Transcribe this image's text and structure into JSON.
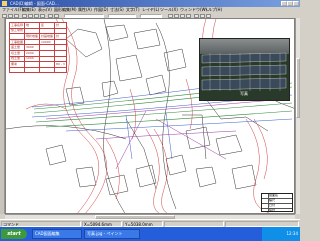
{
  "window": {
    "title": "CAD(D)编辑 - 図面-CAD…"
  },
  "menu": {
    "items": [
      "ファイル(F)",
      "編集(E)",
      "表示(V)",
      "図形編集(M)",
      "属性(A)",
      "作図(D)",
      "寸法(S)",
      "文字(T)",
      "レイヤ(L)",
      "ツール(X)",
      "ウィンドウ(W)",
      "ヘルプ(H)"
    ]
  },
  "table": {
    "rows": [
      [
        "工事名称",
        "地",
        "区",
        "計"
      ],
      [
        "施工場所",
        "",
        "",
        ""
      ],
      [
        "",
        "現状地盤",
        "計画地盤",
        "計"
      ],
      [
        "工事範囲",
        "",
        "10000",
        ""
      ],
      [
        "盛土量",
        "3000",
        "",
        ""
      ],
      [
        "切土量",
        "2000",
        "",
        ""
      ],
      [
        "残土量",
        "1000",
        "",
        ""
      ],
      [
        "備考",
        "",
        "",
        "80 - 3"
      ],
      [
        "",
        "",
        "",
        ""
      ]
    ]
  },
  "photo": {
    "caption": "写真"
  },
  "frame": {
    "rows": [
      "図面名",
      "縮尺",
      "日付",
      "設計"
    ]
  },
  "status": {
    "fields": [
      "コマンド",
      "X=5094.6mm",
      "Y=5038.0mm",
      "",
      ""
    ]
  },
  "taskbar": {
    "start": "start",
    "items": [
      "CAD図面編集",
      "写真.jpg - ペイント"
    ],
    "clock": "12:34"
  }
}
